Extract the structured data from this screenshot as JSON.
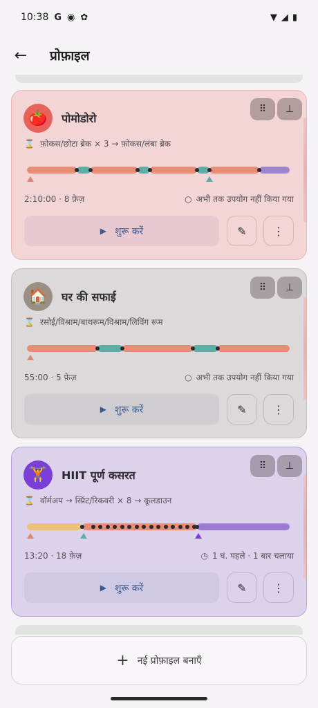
{
  "status_bar": {
    "time": "10:38",
    "left_icons": [
      "google-g-icon",
      "assistant-icon",
      "bug-icon"
    ],
    "right_icons": [
      "wifi-icon",
      "signal-icon",
      "battery-icon"
    ],
    "g_glyph": "G"
  },
  "header": {
    "title": "प्रोफ़ाइल"
  },
  "profiles": [
    {
      "title": "पोमोडोरो",
      "emoji": "🍅",
      "avatar_color": "#e8625c",
      "sequence": "फ़ोकस/छोटा ब्रेक × 3 → फ़ोकस/लंबा ब्रेक",
      "duration": "2:10:00 · 8 फ़ेज़",
      "usage": "अभी तक उपयोग नहीं किया गया",
      "start_label": "शुरू करें"
    },
    {
      "title": "घर की सफाई",
      "emoji": "🏠",
      "avatar_color": "#9b8f84",
      "sequence": "रसोई/विश्राम/बाथरूम/विश्राम/लिविंग रूम",
      "duration": "55:00 · 5 फ़ेज़",
      "usage": "अभी तक उपयोग नहीं किया गया",
      "start_label": "शुरू करें"
    },
    {
      "title": "HIIT पूर्ण कसरत",
      "emoji": "🏋",
      "avatar_color": "#7a3fd6",
      "sequence": "वॉर्मअप → स्प्रिंट/रिकवरी × 8 → कूलडाउन",
      "duration": "13:20 · 18 फ़ेज़",
      "usage": "1 घं. पहले · 1 बार चलाया",
      "start_label": "शुरू करें"
    }
  ],
  "new_profile": {
    "label": "नई प्रोफ़ाइल बनाएँ"
  },
  "colors": {
    "focus": "#e98d76",
    "short_break": "#5fada5",
    "long_break": "#9b86cf",
    "warmup": "#ecc27a",
    "cooldown": "#9b7bd3"
  }
}
